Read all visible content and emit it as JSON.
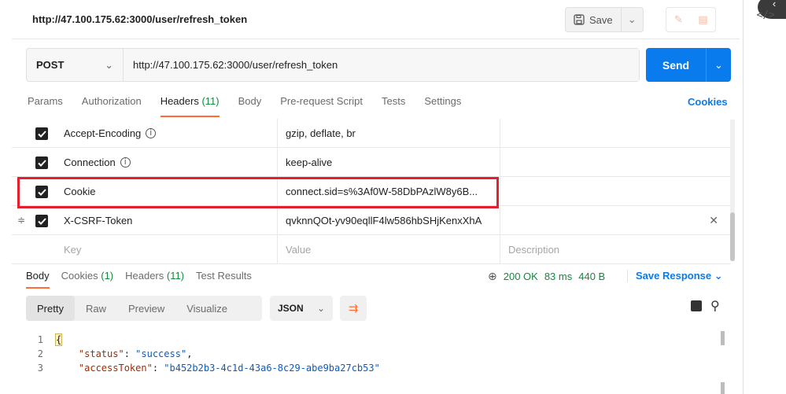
{
  "title": {
    "url": "http://47.100.175.62:3000/user/refresh_token",
    "save_label": "Save"
  },
  "request": {
    "method": "POST",
    "url": "http://47.100.175.62:3000/user/refresh_token",
    "send_label": "Send"
  },
  "request_tabs": [
    {
      "label": "Params",
      "count": ""
    },
    {
      "label": "Authorization",
      "count": ""
    },
    {
      "label": "Headers",
      "count": "(11)"
    },
    {
      "label": "Body",
      "count": ""
    },
    {
      "label": "Pre-request Script",
      "count": ""
    },
    {
      "label": "Tests",
      "count": ""
    },
    {
      "label": "Settings",
      "count": ""
    }
  ],
  "cookies_label": "Cookies",
  "headers": [
    {
      "key": "Accept-Encoding",
      "value": "gzip, deflate, br"
    },
    {
      "key": "Connection",
      "value": "keep-alive"
    },
    {
      "key": "Cookie",
      "value": "connect.sid=s%3Af0W-58DbPAzlW8y6B..."
    },
    {
      "key": "X-CSRF-Token",
      "value": "qvknnQOt-yv90eqllF4lw586hbSHjKenxXhA"
    }
  ],
  "placeholders": {
    "key": "Key",
    "value": "Value",
    "description": "Description"
  },
  "response_tabs": [
    {
      "label": "Body",
      "count": ""
    },
    {
      "label": "Cookies",
      "count": "(1)"
    },
    {
      "label": "Headers",
      "count": "(11)"
    },
    {
      "label": "Test Results",
      "count": ""
    }
  ],
  "response_status": {
    "status": "200 OK",
    "time": "83 ms",
    "size": "440 B"
  },
  "save_response_label": "Save Response",
  "view_options": [
    "Pretty",
    "Raw",
    "Preview",
    "Visualize"
  ],
  "format": "JSON",
  "code_lines": [
    {
      "n": "1",
      "text": "{"
    },
    {
      "n": "2",
      "key": "\"status\"",
      "value": "\"success\"",
      "suffix": ","
    },
    {
      "n": "3",
      "key": "\"accessToken\"",
      "value": "\"b452b2b3-4c1d-43a6-8c29-abe9ba27cb53\"",
      "suffix": ""
    }
  ],
  "rail": {
    "code_icon": "</>",
    "bubble": "‹"
  },
  "colors": {
    "accent": "#ff6c37",
    "send": "#097bed",
    "ok": "#0f8b3b",
    "highlight": "#e5202e"
  }
}
